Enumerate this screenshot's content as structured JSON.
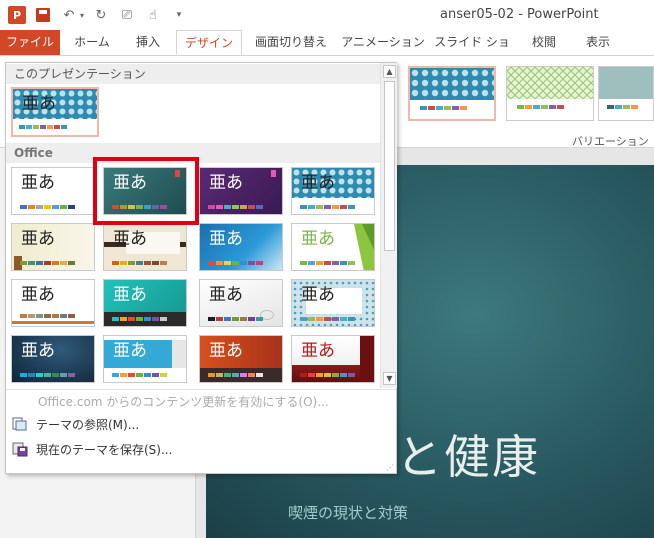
{
  "title_bar": {
    "window_title": "anser05-02 - PowerPoint",
    "app_icon": "P"
  },
  "tabs": [
    {
      "label": "ファイル"
    },
    {
      "label": "ホーム"
    },
    {
      "label": "挿入"
    },
    {
      "label": "デザイン"
    },
    {
      "label": "画面切り替え"
    },
    {
      "label": "アニメーション"
    },
    {
      "label": "スライド ショー"
    },
    {
      "label": "校閲"
    },
    {
      "label": "表示"
    }
  ],
  "ribbon": {
    "variations_label": "バリエーション"
  },
  "theme_gallery": {
    "current_section": "このプレゼンテーション",
    "office_section": "Office",
    "sample_text": "亜あ",
    "themes": [
      {
        "name": "current-theme",
        "bg": "#ffffff",
        "pattern": "#3f93b5",
        "fg": "#222222"
      },
      {
        "name": "office-theme",
        "bg": "#ffffff",
        "fg": "#222222"
      },
      {
        "name": "ion-boardroom",
        "bg": "#2e6466",
        "fg": "#ffffff"
      },
      {
        "name": "ion",
        "bg": "#4b2862",
        "fg": "#ffffff"
      },
      {
        "name": "pattern-blue",
        "bg": "#ffffff",
        "pattern": "#3f93b5",
        "fg": "#222222"
      },
      {
        "name": "organic",
        "bg": "#f3f0dc",
        "fg": "#222222"
      },
      {
        "name": "wood-type",
        "bg": "#efe6d3",
        "fg": "#222222"
      },
      {
        "name": "facet-blue",
        "bg": "#1f7fbf",
        "fg": "#ffffff"
      },
      {
        "name": "facet-green",
        "bg": "#ffffff",
        "fg": "#7ab648"
      },
      {
        "name": "retrospect",
        "bg": "#ffffff",
        "fg": "#222222"
      },
      {
        "name": "slice",
        "bg": "#1fb5b0",
        "fg": "#ffffff"
      },
      {
        "name": "savon",
        "bg": "#f5f5f5",
        "fg": "#222222"
      },
      {
        "name": "dots",
        "bg": "#cfe3ea",
        "pattern": "#4a9fbf",
        "fg": "#222222"
      },
      {
        "name": "integral",
        "bg": "#1b3550",
        "fg": "#ffffff"
      },
      {
        "name": "banded",
        "bg": "#33a9d6",
        "fg": "#ffffff"
      },
      {
        "name": "berlin",
        "bg": "#c3421a",
        "fg": "#ffffff"
      },
      {
        "name": "parallax",
        "bg": "#f5f5f5",
        "fg": "#b21b1b"
      }
    ]
  },
  "menu": {
    "enable_updates": "Office.com からのコンテンツ更新を有効にする(O)...",
    "browse_themes": "テーマの参照(M)...",
    "save_theme": "現在のテーマを保存(S)..."
  },
  "slide": {
    "title": "バコと健康",
    "subtitle": "喫煙の現状と対策"
  }
}
